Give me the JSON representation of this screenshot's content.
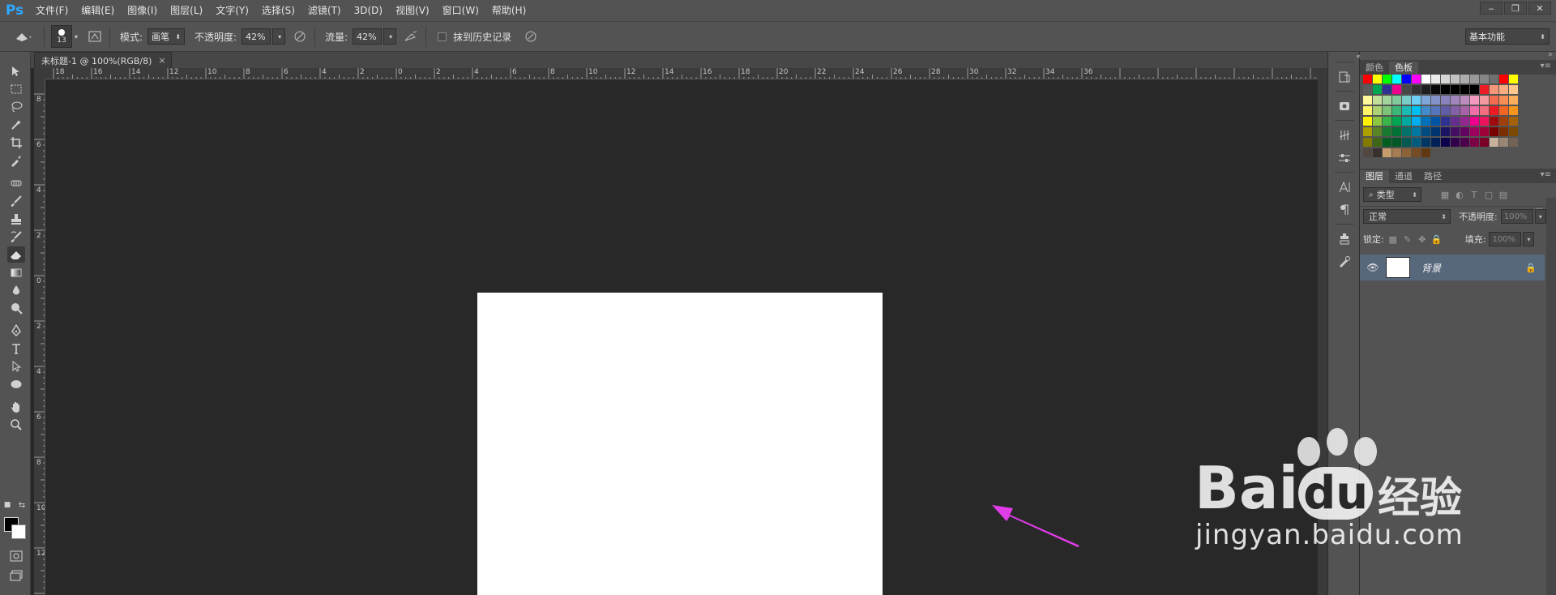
{
  "app": {
    "logo": "Ps"
  },
  "menu": [
    "文件(F)",
    "编辑(E)",
    "图像(I)",
    "图层(L)",
    "文字(Y)",
    "选择(S)",
    "滤镜(T)",
    "3D(D)",
    "视图(V)",
    "窗口(W)",
    "帮助(H)"
  ],
  "window_controls": [
    "‒",
    "❐",
    "✕"
  ],
  "options": {
    "brush_size": "13",
    "mode_label": "模式:",
    "mode_value": "画笔",
    "opacity_label": "不透明度:",
    "opacity_value": "42%",
    "flow_label": "流量:",
    "flow_value": "42%",
    "erase_history_label": "抹到历史记录",
    "workspace": "基本功能"
  },
  "document": {
    "tab_title": "未标题-1 @ 100%(RGB/8)",
    "close": "×",
    "canvas_color": "#ffffff"
  },
  "ruler_top": [
    "18",
    "16",
    "14",
    "12",
    "10",
    "8",
    "6",
    "4",
    "2",
    "0",
    "2",
    "4",
    "6",
    "8",
    "10",
    "12",
    "14",
    "16",
    "18",
    "20",
    "22",
    "24",
    "26",
    "28",
    "30",
    "32",
    "34",
    "36"
  ],
  "ruler_left": [
    "8",
    "6",
    "4",
    "2",
    "0",
    "2",
    "4",
    "6",
    "8",
    "10",
    "12"
  ],
  "panels": {
    "color_tabs": [
      "颜色",
      "色板"
    ],
    "layer_tabs": [
      "图层",
      "通道",
      "路径"
    ],
    "filter_kind": "类型",
    "blend_mode": "正常",
    "opacity_label": "不透明度:",
    "opacity_value": "100%",
    "lock_label": "锁定:",
    "fill_label": "填充:",
    "fill_value": "100%",
    "layer_name": "背景"
  },
  "swatches": [
    [
      "#ff0000",
      "#ffff00",
      "#00ff00",
      "#00ffff",
      "#0000ff",
      "#ff00ff",
      "#ffffff",
      "#ebebeb",
      "#d6d6d6",
      "#c2c2c2",
      "#adadad",
      "#999999",
      "#858585",
      "#707070",
      "#ff0000",
      "#ffff00"
    ],
    [
      "#5c5c5c",
      "#00a651",
      "#2e3192",
      "#ec008c",
      "#474747",
      "#333333",
      "#1f1f1f",
      "#0a0a0a",
      "#000000",
      "#000000",
      "#000000",
      "#000000",
      "#ed1c24",
      "#f7977a",
      "#fbad82",
      "#fdc68a"
    ],
    [
      "#fff799",
      "#c4df9b",
      "#a3d39c",
      "#82ca9c",
      "#7accc8",
      "#6dcff6",
      "#7da7d9",
      "#8393ca",
      "#8781bd",
      "#a186be",
      "#bd8cbf",
      "#f49ac1",
      "#f5989d",
      "#f26c4f",
      "#f68e56",
      "#fbaf5d"
    ],
    [
      "#fff568",
      "#acd373",
      "#7cc576",
      "#3bb878",
      "#1abbb4",
      "#00bff3",
      "#438ccb",
      "#5574b9",
      "#605ca8",
      "#855fa8",
      "#a763a8",
      "#f06eaa",
      "#f26d7d",
      "#ed1c24",
      "#f26522",
      "#f7941d"
    ],
    [
      "#fff200",
      "#8dc73f",
      "#39b54a",
      "#00a651",
      "#00a99d",
      "#00aeef",
      "#0072bc",
      "#0054a6",
      "#2e3192",
      "#662d91",
      "#92278f",
      "#ec008c",
      "#ed145b",
      "#9e0b0f",
      "#a0410d",
      "#a36209"
    ],
    [
      "#aba000",
      "#598527",
      "#197b30",
      "#007236",
      "#00746b",
      "#0076a3",
      "#004b80",
      "#003471",
      "#1b1464",
      "#440e62",
      "#630460",
      "#9e005d",
      "#9e0039",
      "#790000",
      "#7b2e00",
      "#7d4900"
    ],
    [
      "#827b00",
      "#406618",
      "#005e20",
      "#005826",
      "#005952",
      "#005b7f",
      "#003663",
      "#002157",
      "#0d004c",
      "#32004b",
      "#4b0049",
      "#7b0046",
      "#7a0026",
      "#c7b299",
      "#998675",
      "#736357"
    ],
    [
      "#534741",
      "#37302d",
      "#c69c6d",
      "#a67c52",
      "#8c6239",
      "#754c24",
      "#603913"
    ]
  ]
}
